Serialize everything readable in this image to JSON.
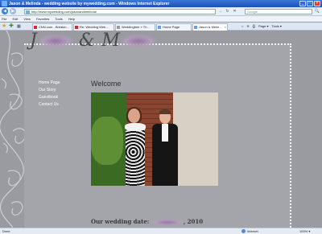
{
  "window": {
    "title": "Jason & Melinda - wedding website by mywedding.com - Windows Internet Explorer",
    "minimize": "_",
    "maximize": "□",
    "close": "×"
  },
  "addressbar": {
    "back": "◀",
    "forward": "▶",
    "url": "http://www.mywedding.com/jasonandmelinda/",
    "refresh": "↻",
    "stop": "✕",
    "go": "→",
    "search_placeholder": "Google",
    "search_btn": "🔍"
  },
  "menu": [
    "File",
    "Edit",
    "View",
    "Favorites",
    "Tools",
    "Help"
  ],
  "tabs": [
    {
      "label": "CNN.com - Breakin...",
      "active": false
    },
    {
      "label": "Re: Wedding Web...",
      "active": false
    },
    {
      "label": "Weddingbee » Th...",
      "active": false
    },
    {
      "label": "Home Page",
      "active": false
    },
    {
      "label": "Jason & Melin...",
      "active": true
    }
  ],
  "toolbar": {
    "home": "⌂",
    "feeds": "≋",
    "print": "⎙",
    "page": "Page ▾",
    "tools": "Tools ▾"
  },
  "page": {
    "header_first": "J",
    "header_amp": "& M",
    "nav": [
      "Home Page",
      "Our Story",
      "Guestbook",
      "Contact Us"
    ],
    "welcome": "Welcome",
    "date_prefix": "Our wedding date: ",
    "date_year": ", 2010"
  },
  "status": {
    "text": "Done",
    "zone": "Internet",
    "zoom": "100% ▾"
  },
  "colors": {
    "background": "#9a9ba0",
    "panel": "#a4a5aa",
    "titlebar": "#1b4fb4"
  }
}
